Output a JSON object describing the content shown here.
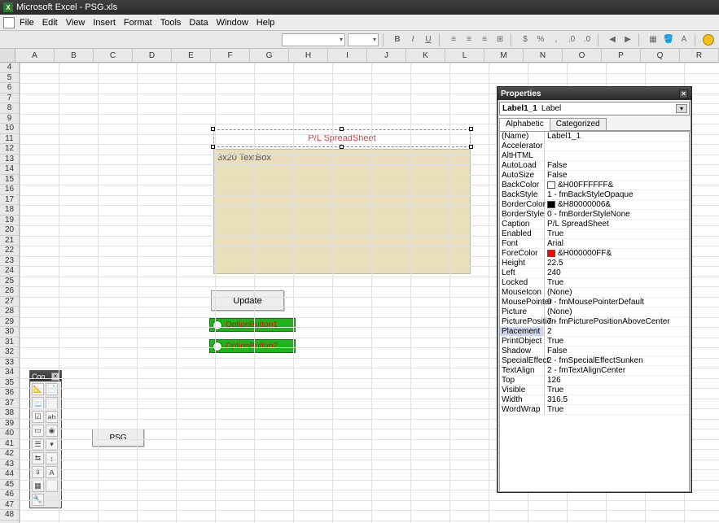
{
  "title": "Microsoft Excel - PSG.xls",
  "menu": [
    "File",
    "Edit",
    "View",
    "Insert",
    "Format",
    "Tools",
    "Data",
    "Window",
    "Help"
  ],
  "columns": [
    "A",
    "B",
    "C",
    "D",
    "E",
    "F",
    "G",
    "H",
    "I",
    "J",
    "K",
    "L",
    "M",
    "N",
    "O",
    "P",
    "Q",
    "R"
  ],
  "rows_start": 4,
  "rows_end": 48,
  "label_caption": "P/L SpreadSheet",
  "textbox_text": "3x20 TextBox",
  "update_label": "Update",
  "opt1_label": "OptionButton1",
  "opt2_label": "OptionButton2",
  "psg_label": "PSG",
  "toolbox_title": "Con",
  "props_title": "Properties",
  "props_object_name": "Label1_1",
  "props_object_type": "Label",
  "tabs": {
    "alpha": "Alphabetic",
    "cat": "Categorized"
  },
  "properties": [
    {
      "k": "(Name)",
      "v": "Label1_1"
    },
    {
      "k": "Accelerator",
      "v": ""
    },
    {
      "k": "AltHTML",
      "v": ""
    },
    {
      "k": "AutoLoad",
      "v": "False"
    },
    {
      "k": "AutoSize",
      "v": "False"
    },
    {
      "k": "BackColor",
      "v": "&H00FFFFFF&",
      "swatch": "#ffffff"
    },
    {
      "k": "BackStyle",
      "v": "1 - fmBackStyleOpaque"
    },
    {
      "k": "BorderColor",
      "v": "&H80000006&",
      "swatch": "#000000"
    },
    {
      "k": "BorderStyle",
      "v": "0 - fmBorderStyleNone"
    },
    {
      "k": "Caption",
      "v": "P/L SpreadSheet"
    },
    {
      "k": "Enabled",
      "v": "True"
    },
    {
      "k": "Font",
      "v": "Arial"
    },
    {
      "k": "ForeColor",
      "v": "&H000000FF&",
      "swatch": "#ff0000"
    },
    {
      "k": "Height",
      "v": "22.5"
    },
    {
      "k": "Left",
      "v": "240"
    },
    {
      "k": "Locked",
      "v": "True"
    },
    {
      "k": "MouseIcon",
      "v": "(None)"
    },
    {
      "k": "MousePointer",
      "v": "0 - fmMousePointerDefault"
    },
    {
      "k": "Picture",
      "v": "(None)"
    },
    {
      "k": "PicturePosition",
      "v": "7 - fmPicturePositionAboveCenter"
    },
    {
      "k": "Placement",
      "v": "2",
      "selected": true
    },
    {
      "k": "PrintObject",
      "v": "True"
    },
    {
      "k": "Shadow",
      "v": "False"
    },
    {
      "k": "SpecialEffect",
      "v": "2 - fmSpecialEffectSunken"
    },
    {
      "k": "TextAlign",
      "v": "2 - fmTextAlignCenter"
    },
    {
      "k": "Top",
      "v": "126"
    },
    {
      "k": "Visible",
      "v": "True"
    },
    {
      "k": "Width",
      "v": "316.5"
    },
    {
      "k": "WordWrap",
      "v": "True"
    }
  ]
}
